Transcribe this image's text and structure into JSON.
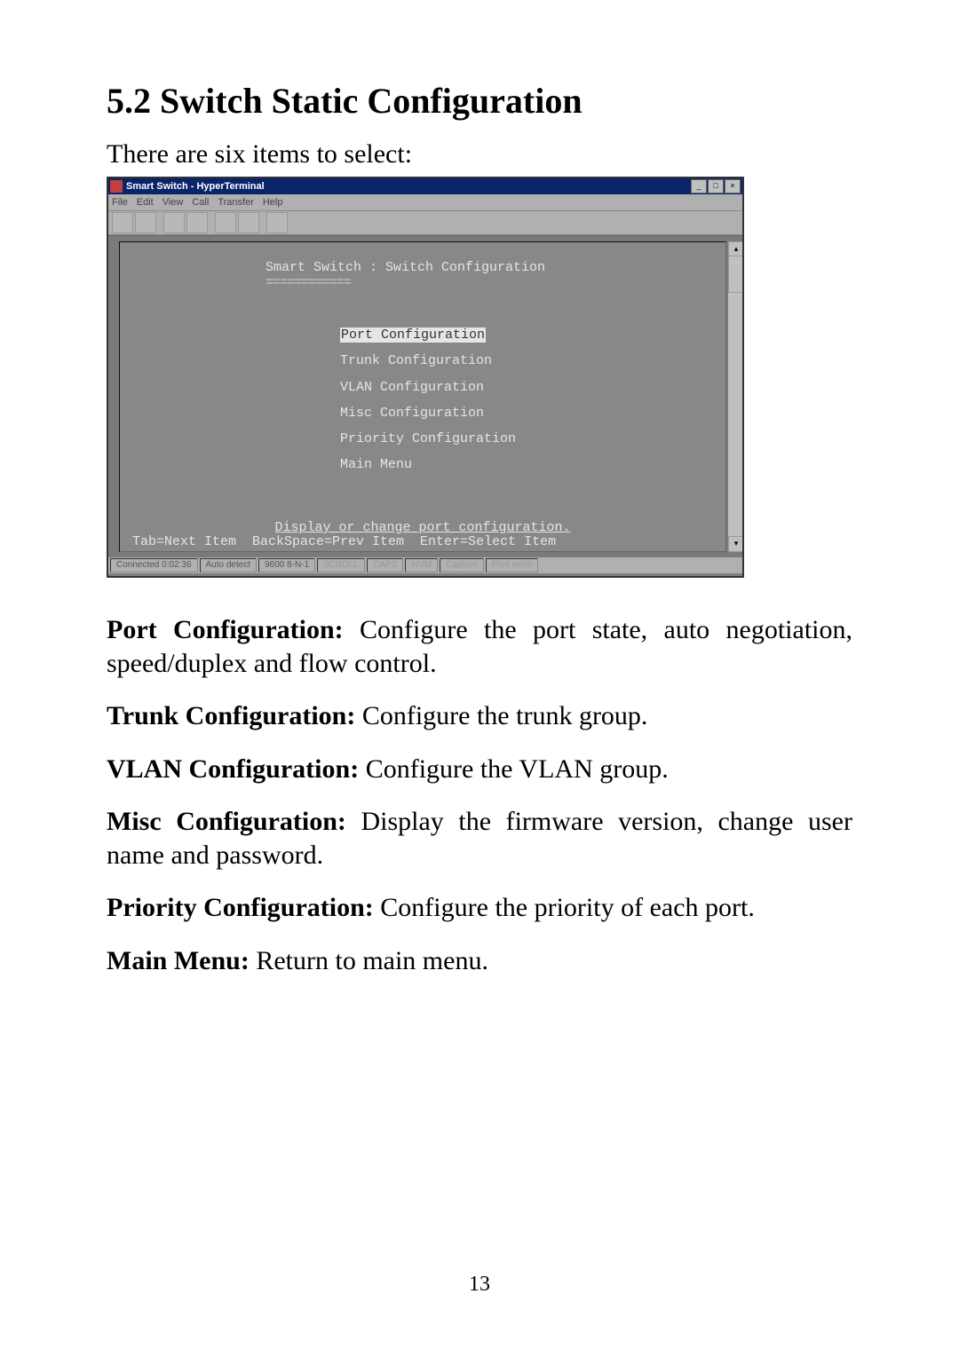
{
  "heading": "5.2 Switch Static Configuration",
  "intro": "There are six items to select:",
  "terminal": {
    "window_title": "Smart Switch - HyperTerminal",
    "menubar": [
      "File",
      "Edit",
      "View",
      "Call",
      "Transfer",
      "Help"
    ],
    "screen_title": "Smart Switch : Switch Configuration",
    "menu_items": [
      {
        "label": "Port Configuration",
        "selected": true
      },
      {
        "label": "Trunk Configuration",
        "selected": false
      },
      {
        "label": "VLAN Configuration",
        "selected": false
      },
      {
        "label": "Misc Configuration",
        "selected": false
      },
      {
        "label": "Priority Configuration",
        "selected": false
      },
      {
        "label": "Main Menu",
        "selected": false
      }
    ],
    "help_line": "Display or change port configuration.",
    "nav_line": "Tab=Next Item  BackSpace=Prev Item  Enter=Select Item",
    "statusbar": {
      "connected": "Connected 0:02:36",
      "detect": "Auto detect",
      "mode": "9600 8-N-1",
      "fields": [
        "SCROLL",
        "CAPS",
        "NUM",
        "Capture",
        "Print echo"
      ]
    }
  },
  "descriptions": [
    {
      "title": "Port Configuration:",
      "body": " Configure the port state, auto negotiation, speed/duplex and flow control."
    },
    {
      "title": "Trunk Configuration:",
      "body": " Configure the trunk group."
    },
    {
      "title": "VLAN Configuration:",
      "body": " Configure the VLAN group."
    },
    {
      "title": "Misc Configuration:",
      "body": " Display the firmware version, change user name and password."
    },
    {
      "title": "Priority Configuration:",
      "body": " Configure the priority of each port."
    },
    {
      "title": "Main Menu:",
      "body": " Return to main menu."
    }
  ],
  "page_number": "13"
}
